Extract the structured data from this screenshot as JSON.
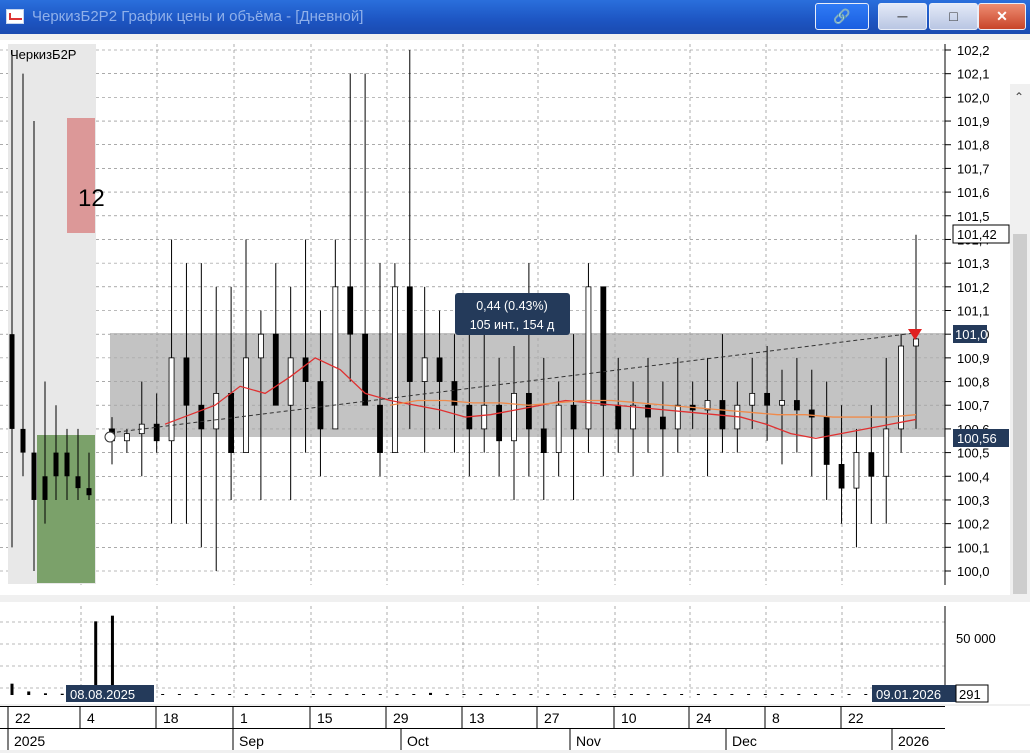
{
  "window": {
    "title": "ЧеркизБ2Р2 График цены и объёма - [Дневной]"
  },
  "chart_label": "ЧеркизБ2Р",
  "level_marker": "12",
  "tooltip": {
    "line1": "0,44 (0.43%)",
    "line2": "105 инт., 154 д"
  },
  "price_axis": [
    "102,2",
    "102,1",
    "102,0",
    "101,9",
    "101,8",
    "101,7",
    "101,6",
    "101,5",
    "101,4",
    "101,3",
    "101,2",
    "101,1",
    "101,0",
    "100,9",
    "100,8",
    "100,7",
    "100,6",
    "100,5",
    "100,4",
    "100,3",
    "100,2",
    "100,1",
    "100,0"
  ],
  "price_labels": {
    "high": "101,42",
    "level": "101,0",
    "last": "100,56"
  },
  "volume_axis": {
    "label": "50 000",
    "last": "291"
  },
  "date_markers": {
    "start": "08.08.2025",
    "end": "09.01.2026"
  },
  "x_axis": {
    "days": [
      "22",
      "4",
      "18",
      "1",
      "15",
      "29",
      "13",
      "27",
      "10",
      "24",
      "8",
      "22"
    ],
    "months": [
      "2025",
      "Sep",
      "Oct",
      "Nov",
      "Dec",
      "2026"
    ]
  },
  "colors": {
    "ma_red": "#e03030",
    "ma_orange": "#f08a4a",
    "zone": "#a9a9a9",
    "candle": "#000000"
  },
  "chart_data": {
    "type": "candlestick",
    "ylim": [
      100.0,
      102.2
    ],
    "series": [
      {
        "name": "price",
        "values": [
          [
            100.6,
            100.65,
            100.45,
            100.55
          ],
          [
            100.55,
            100.6,
            100.5,
            100.58
          ],
          [
            100.58,
            100.8,
            100.4,
            100.62
          ],
          [
            100.62,
            100.75,
            100.5,
            100.55
          ],
          [
            100.55,
            101.4,
            100.2,
            100.9
          ],
          [
            100.9,
            101.3,
            100.2,
            100.7
          ],
          [
            100.7,
            101.3,
            100.1,
            100.6
          ],
          [
            100.6,
            101.2,
            100.0,
            100.75
          ],
          [
            100.75,
            101.2,
            100.3,
            100.5
          ],
          [
            100.5,
            101.4,
            100.6,
            100.9
          ],
          [
            100.9,
            101.1,
            100.3,
            101.0
          ],
          [
            101.0,
            101.3,
            100.8,
            100.7
          ],
          [
            100.7,
            101.2,
            100.3,
            100.9
          ],
          [
            100.9,
            101.4,
            100.5,
            100.8
          ],
          [
            100.8,
            101.1,
            100.4,
            100.6
          ],
          [
            100.6,
            101.4,
            100.6,
            101.2
          ],
          [
            101.2,
            102.1,
            100.8,
            101.0
          ],
          [
            101.0,
            102.1,
            100.9,
            100.7
          ],
          [
            100.7,
            101.3,
            100.4,
            100.5
          ],
          [
            100.5,
            101.3,
            100.9,
            101.2
          ],
          [
            101.2,
            102.2,
            100.6,
            100.8
          ],
          [
            100.8,
            101.2,
            100.5,
            100.9
          ],
          [
            100.9,
            101.1,
            100.6,
            100.8
          ],
          [
            100.8,
            101.0,
            100.5,
            100.7
          ],
          [
            100.7,
            101.1,
            100.4,
            100.6
          ],
          [
            100.6,
            101.0,
            100.5,
            100.7
          ],
          [
            100.7,
            100.9,
            100.4,
            100.55
          ],
          [
            100.55,
            100.95,
            100.3,
            100.75
          ],
          [
            100.75,
            101.3,
            100.4,
            100.6
          ],
          [
            100.6,
            100.9,
            100.3,
            100.5
          ],
          [
            100.5,
            100.8,
            100.4,
            100.7
          ],
          [
            100.7,
            101.0,
            100.3,
            100.6
          ],
          [
            100.6,
            101.3,
            100.5,
            101.2
          ],
          [
            101.2,
            101.1,
            100.4,
            100.7
          ],
          [
            100.7,
            100.9,
            100.5,
            100.6
          ],
          [
            100.6,
            100.8,
            100.4,
            100.7
          ],
          [
            100.7,
            100.9,
            100.5,
            100.65
          ],
          [
            100.65,
            100.8,
            100.4,
            100.6
          ],
          [
            100.6,
            100.9,
            100.5,
            100.7
          ],
          [
            100.7,
            100.8,
            100.6,
            100.68
          ],
          [
            100.68,
            100.9,
            100.4,
            100.72
          ],
          [
            100.72,
            101.0,
            100.5,
            100.6
          ],
          [
            100.6,
            100.8,
            100.5,
            100.7
          ],
          [
            100.7,
            100.9,
            100.6,
            100.75
          ],
          [
            100.75,
            100.95,
            100.55,
            100.7
          ],
          [
            100.7,
            100.85,
            100.45,
            100.72
          ],
          [
            100.72,
            100.9,
            100.5,
            100.68
          ],
          [
            100.68,
            100.85,
            100.4,
            100.65
          ],
          [
            100.65,
            100.8,
            100.3,
            100.45
          ],
          [
            100.45,
            100.7,
            100.2,
            100.35
          ],
          [
            100.35,
            100.6,
            100.1,
            100.5
          ],
          [
            100.5,
            100.7,
            100.2,
            100.4
          ],
          [
            100.4,
            100.9,
            100.2,
            100.6
          ],
          [
            100.6,
            101.0,
            100.5,
            100.95
          ],
          [
            100.95,
            101.42,
            100.6,
            100.98
          ]
        ]
      }
    ],
    "volume": [
      8000,
      2500,
      1200,
      900,
      700,
      52000,
      56000,
      900,
      500,
      400,
      300,
      350,
      300,
      400,
      380,
      300,
      350,
      300,
      500,
      400,
      700,
      300,
      350,
      250,
      300,
      1500,
      400,
      300,
      350,
      300,
      400,
      350,
      300,
      250,
      300,
      280,
      350,
      300,
      250,
      300,
      350,
      300,
      280,
      300,
      350,
      300,
      250,
      300,
      280,
      300,
      350,
      300,
      280,
      300,
      291
    ],
    "ma_red": [
      100.62,
      100.66,
      100.7,
      100.78,
      100.75,
      100.82,
      100.9,
      100.85,
      100.75,
      100.72,
      100.7,
      100.68,
      100.65,
      100.66,
      100.68,
      100.7,
      100.72,
      100.71,
      100.7,
      100.69,
      100.68,
      100.67,
      100.66,
      100.65,
      100.62,
      100.58,
      100.56,
      100.58,
      100.6,
      100.62,
      100.64
    ],
    "ma_orange": [
      100.7,
      100.72,
      100.72,
      100.71,
      100.71,
      100.7,
      100.71,
      100.72,
      100.72,
      100.71,
      100.7,
      100.69,
      100.68,
      100.67,
      100.66,
      100.66,
      100.65,
      100.65,
      100.65,
      100.66
    ]
  }
}
